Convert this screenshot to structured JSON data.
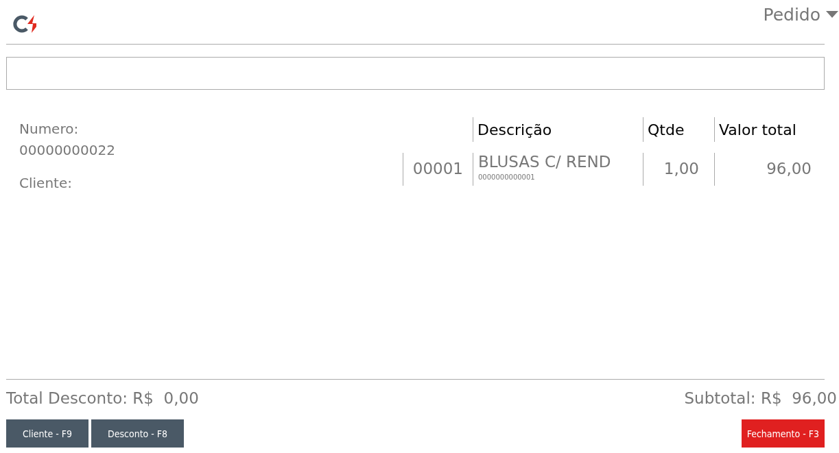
{
  "header": {
    "menu_label": "Pedido"
  },
  "order": {
    "number_label": "Numero:",
    "number": "00000000022",
    "client_label": "Cliente:"
  },
  "table": {
    "columns": [
      "Descrição",
      "Qtde",
      "Valor total"
    ],
    "rows": [
      {
        "code": "00001",
        "description": "BLUSAS C/ REND",
        "barcode": "0000000000001",
        "qty": "1,00",
        "total": "96,00"
      }
    ]
  },
  "totals": {
    "discount_label": "Total Desconto: R$",
    "discount": "0,00",
    "subtotal_label": "Subtotal: R$",
    "subtotal": "96,00"
  },
  "buttons": [
    {
      "label": "Cliente - F9",
      "kind": "secondary"
    },
    {
      "label": "Desconto - F8",
      "kind": "secondary"
    },
    {
      "label": "Fechamento - F3",
      "kind": "primary"
    }
  ]
}
